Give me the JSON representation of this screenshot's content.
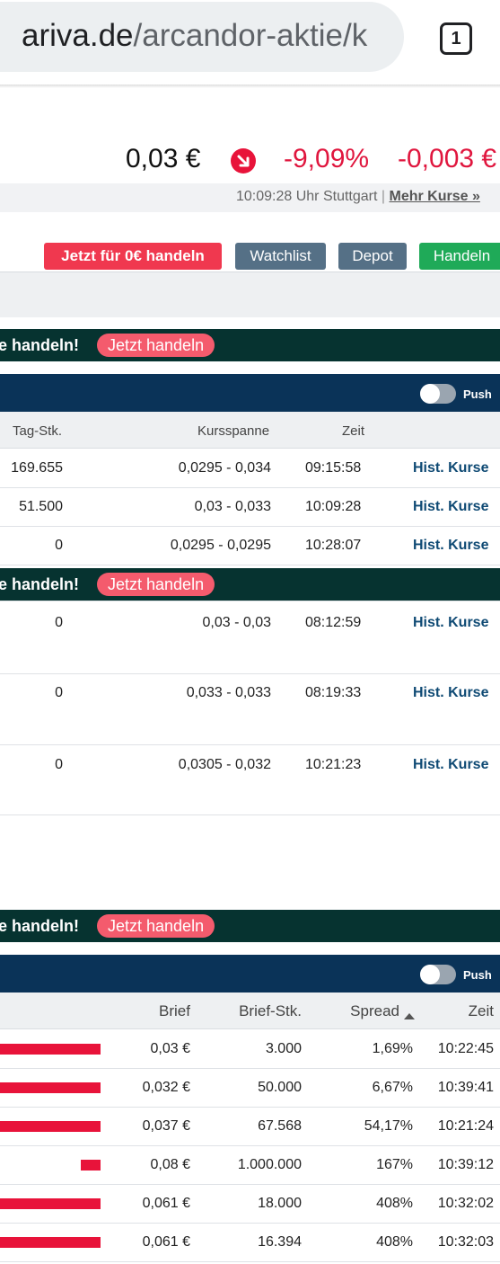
{
  "browser": {
    "url_host": "ariva.de",
    "url_path": "/arcandor-aktie/k",
    "tab_count": "1"
  },
  "quote": {
    "price": "0,03 €",
    "change_pct": "-9,09%",
    "change_abs": "-0,003 €",
    "time_info": "10:09:28 Uhr Stuttgart",
    "separator": "|",
    "more_link": "Mehr Kurse »",
    "down_color": "#e8133a"
  },
  "actions": {
    "trade_free": "Jetzt für 0€ handeln",
    "watchlist": "Watchlist",
    "depot": "Depot",
    "trade": "Handeln"
  },
  "promo": {
    "text": "e handeln!",
    "button": "Jetzt handeln"
  },
  "push_label": "Push",
  "table1": {
    "headers": [
      "Tag-Stk.",
      "Kursspanne",
      "Zeit"
    ],
    "rows": [
      {
        "stk": "169.655",
        "range": "0,0295 - 0,034",
        "time": "09:15:58",
        "link": "Hist. Kurse"
      },
      {
        "stk": "51.500",
        "range": "0,03 - 0,033",
        "time": "10:09:28",
        "link": "Hist. Kurse"
      },
      {
        "stk": "0",
        "range": "0,0295 - 0,0295",
        "time": "10:28:07",
        "link": "Hist. Kurse"
      }
    ]
  },
  "table2": {
    "rows": [
      {
        "stk": "0",
        "range": "0,03 - 0,03",
        "time": "08:12:59",
        "link": "Hist. Kurse"
      },
      {
        "stk": "0",
        "range": "0,033 - 0,033",
        "time": "08:19:33",
        "link": "Hist. Kurse"
      },
      {
        "stk": "0",
        "range": "0,0305 - 0,032",
        "time": "10:21:23",
        "link": "Hist. Kurse"
      }
    ]
  },
  "table3": {
    "headers": [
      "Brief",
      "Brief-Stk.",
      "Spread",
      "Zeit"
    ],
    "sort_icon": "sort-up-icon",
    "rows": [
      {
        "brief": "0,03 €",
        "stk": "3.000",
        "spread": "1,69%",
        "time": "10:22:45",
        "bar": 1.0
      },
      {
        "brief": "0,032 €",
        "stk": "50.000",
        "spread": "6,67%",
        "time": "10:39:41",
        "bar": 1.0
      },
      {
        "brief": "0,037 €",
        "stk": "67.568",
        "spread": "54,17%",
        "time": "10:21:24",
        "bar": 1.0
      },
      {
        "brief": "0,08 €",
        "stk": "1.000.000",
        "spread": "167%",
        "time": "10:39:12",
        "bar": 0.2
      },
      {
        "brief": "0,061 €",
        "stk": "18.000",
        "spread": "408%",
        "time": "10:32:02",
        "bar": 1.0
      },
      {
        "brief": "0,061 €",
        "stk": "16.394",
        "spread": "408%",
        "time": "10:32:03",
        "bar": 1.0
      }
    ]
  }
}
